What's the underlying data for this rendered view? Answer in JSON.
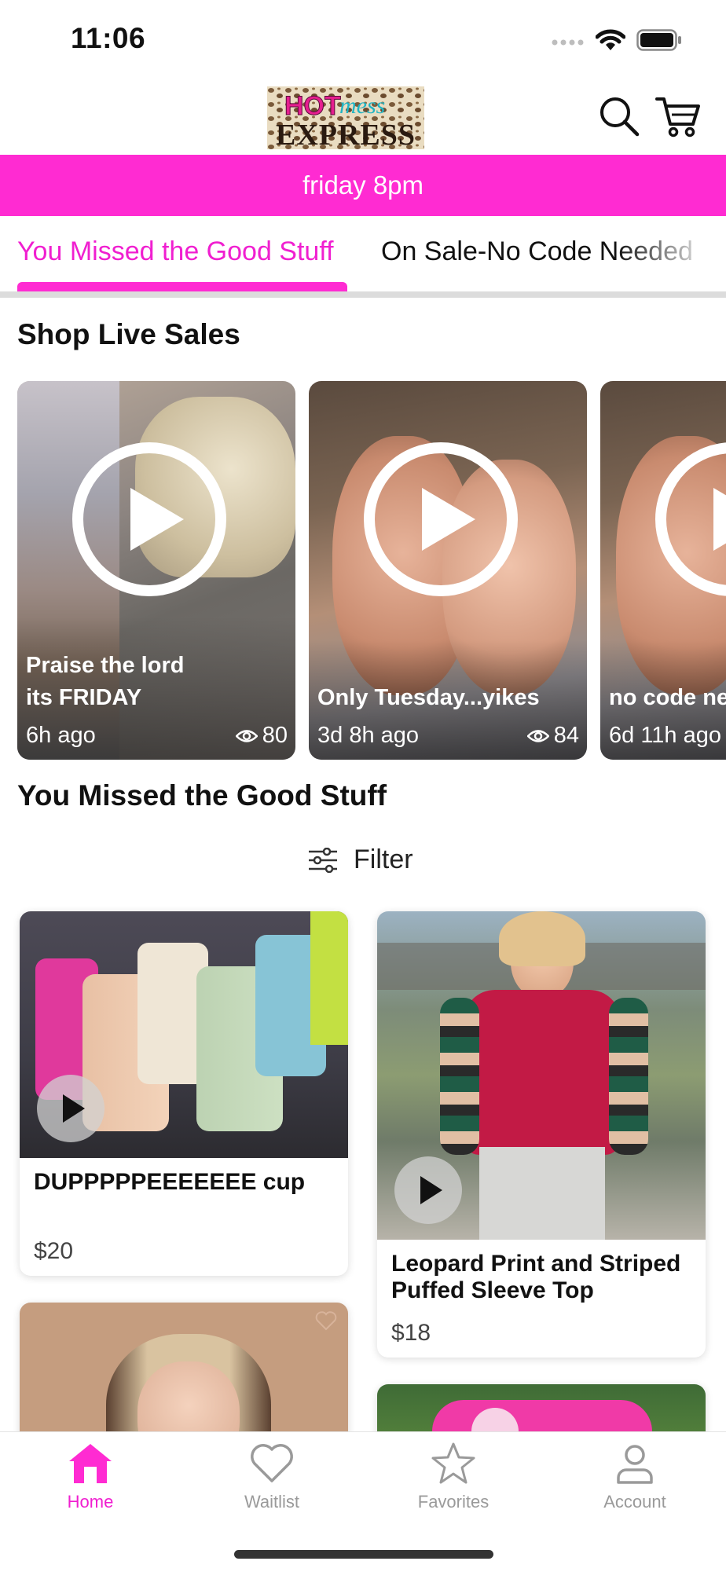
{
  "status": {
    "time": "11:06"
  },
  "header": {
    "logo": {
      "line1_a": "HOT",
      "line1_b": "mess",
      "line2": "EXPRESS"
    },
    "search_icon": "search-icon",
    "cart_icon": "cart-icon"
  },
  "banner": {
    "text": "friday 8pm"
  },
  "tabs": [
    {
      "label": "You Missed the Good Stuff",
      "active": true
    },
    {
      "label": "On Sale-No Code Needed",
      "active": false
    }
  ],
  "live_section": {
    "title": "Shop Live Sales",
    "items": [
      {
        "title_line1": "Praise the lord",
        "title_line2": "its FRIDAY",
        "ago": "6h ago",
        "views": "80"
      },
      {
        "title_line1": "Only Tuesday...yikes",
        "ago": "3d 8h ago",
        "views": "84"
      },
      {
        "title_line1": "no code ne",
        "ago": "6d 11h ago"
      }
    ]
  },
  "products_section": {
    "title": "You Missed the Good Stuff",
    "filter_label": "Filter",
    "items": [
      {
        "name": "DUPPPPPEEEEEEE cup",
        "price": "$20"
      },
      {
        "name_line1": "Leopard Print and Striped",
        "name_line2": "Puffed Sleeve Top",
        "price": "$18"
      }
    ]
  },
  "bottom_nav": [
    {
      "label": "Home",
      "icon": "home-icon",
      "active": true
    },
    {
      "label": "Waitlist",
      "icon": "heart-icon",
      "active": false
    },
    {
      "label": "Favorites",
      "icon": "star-icon",
      "active": false
    },
    {
      "label": "Account",
      "icon": "account-icon",
      "active": false
    }
  ],
  "colors": {
    "accent": "#ff2bd2",
    "accent_text": "#f01fd0",
    "inactive": "#9a9a9a"
  }
}
